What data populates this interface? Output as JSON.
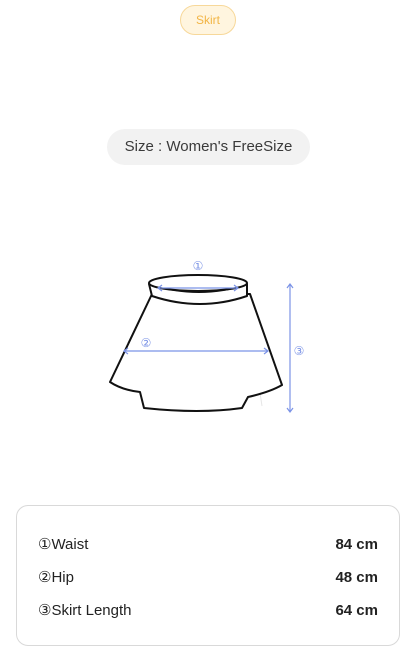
{
  "category": "Skirt",
  "size_label": "Size : Women's FreeSize",
  "diagram": {
    "marker_1": "①",
    "marker_2": "②",
    "marker_3": "③",
    "line_color": "#7b93e6",
    "outline_color": "#111111"
  },
  "measurements": [
    {
      "label": "①Waist",
      "value": "84 cm"
    },
    {
      "label": "②Hip",
      "value": "48 cm"
    },
    {
      "label": "③Skirt Length",
      "value": "64 cm"
    }
  ],
  "colors": {
    "accent": "#f2b545",
    "tag_bg": "#fff5df",
    "tag_border": "#f7d89a",
    "pill_bg": "#f2f2f2"
  }
}
